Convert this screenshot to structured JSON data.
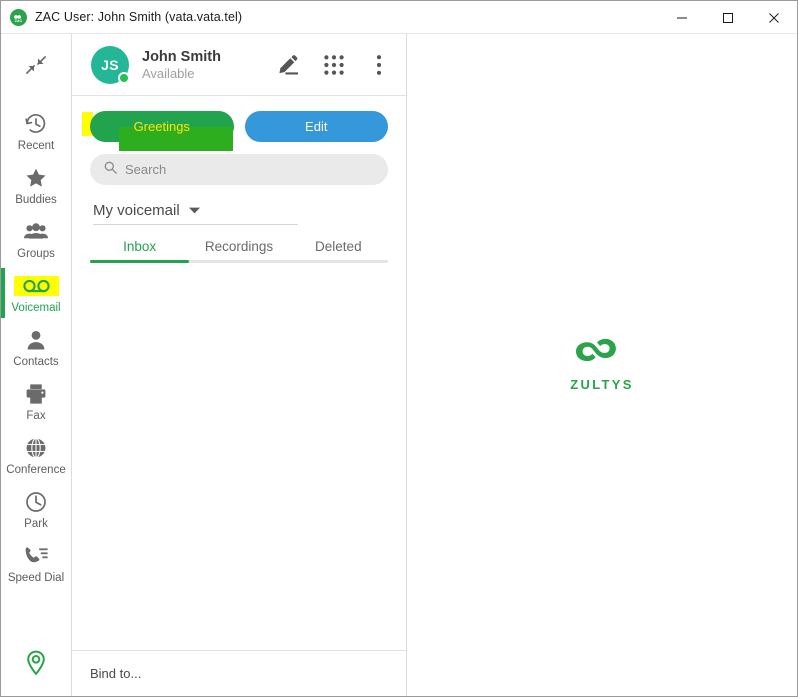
{
  "window": {
    "title": "ZAC User: John Smith (vata.vata.tel)",
    "app_icon": "zac-logo-icon",
    "controls": {
      "minimize": "minimize-icon",
      "maximize": "maximize-icon",
      "close": "close-icon"
    }
  },
  "rail": {
    "collapse_icon": "collapse-arrows-icon",
    "location_icon": "location-pin-icon",
    "active_item": "Voicemail",
    "items": [
      {
        "label": "Recent",
        "icon": "history-clock-icon",
        "active": false,
        "highlighted": false
      },
      {
        "label": "Buddies",
        "icon": "star-icon",
        "active": false,
        "highlighted": false
      },
      {
        "label": "Groups",
        "icon": "people-group-icon",
        "active": false,
        "highlighted": false
      },
      {
        "label": "Voicemail",
        "icon": "voicemail-icon",
        "active": true,
        "highlighted": true
      },
      {
        "label": "Contacts",
        "icon": "person-icon",
        "active": false,
        "highlighted": false
      },
      {
        "label": "Fax",
        "icon": "printer-fax-icon",
        "active": false,
        "highlighted": false
      },
      {
        "label": "Conference",
        "icon": "globe-icon",
        "active": false,
        "highlighted": false
      },
      {
        "label": "Park",
        "icon": "clock-park-icon",
        "active": false,
        "highlighted": false
      },
      {
        "label": "Speed Dial",
        "icon": "phone-list-icon",
        "active": false,
        "highlighted": false
      }
    ]
  },
  "user_header": {
    "avatar_initials": "JS",
    "name": "John Smith",
    "status": "Available",
    "presence_color": "#25c04d",
    "actions": [
      {
        "name": "edit-pencil-icon"
      },
      {
        "name": "dialpad-grid-icon"
      },
      {
        "name": "more-vertical-icon"
      }
    ]
  },
  "voicemail": {
    "greetings_button": "Greetings",
    "edit_button": "Edit",
    "search": {
      "placeholder": "Search",
      "value": "",
      "icon": "search-icon"
    },
    "folder": {
      "label": "My voicemail",
      "chevron": "chevron-down-icon"
    },
    "tabs": [
      {
        "label": "Inbox",
        "active": true
      },
      {
        "label": "Recordings",
        "active": false
      },
      {
        "label": "Deleted",
        "active": false
      }
    ],
    "footer": {
      "bind_label": "Bind to..."
    }
  },
  "right_panel": {
    "brand_word": "ZULTYS",
    "brand_mark": "zultys-infinity-logo"
  },
  "colors": {
    "green": "#22a44f",
    "blue": "#3498db",
    "teal_avatar": "#23b798",
    "highlight_yellow": "#ffff00",
    "brand_green": "#2aa34a"
  }
}
